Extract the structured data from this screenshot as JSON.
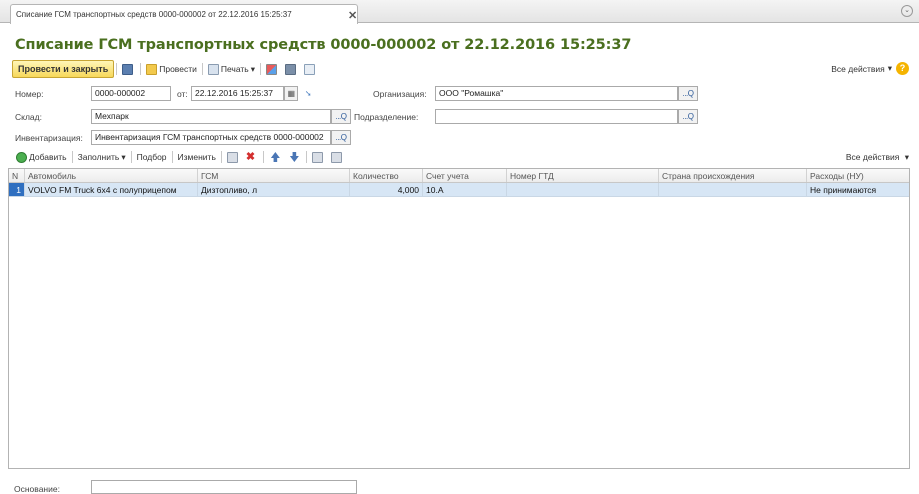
{
  "tab": {
    "title": "Списание ГСМ транспортных средств 0000-000002 от 22.12.2016 15:25:37",
    "close": "✕",
    "menu": "⌄"
  },
  "document": {
    "title": "Списание ГСМ транспортных средств 0000-000002 от 22.12.2016 15:25:37"
  },
  "toolbar": {
    "post_and_close": "Провести и закрыть",
    "post": "Провести",
    "print": "Печать",
    "print_arrow": "▾",
    "all_actions": "Все действия",
    "all_actions_arrow": "▾",
    "help": "?"
  },
  "form": {
    "number_label": "Номер:",
    "number_value": "0000-000002",
    "date_label": "от:",
    "date_value": "22.12.2016 15:25:37",
    "org_label": "Организация:",
    "org_value": "ООО \"Ромашка\"",
    "warehouse_label": "Склад:",
    "warehouse_value": "Мехпарк",
    "department_label": "Подразделение:",
    "department_value": "",
    "inventory_label": "Инвентаризация:",
    "inventory_value": "Инвентаризация ГСМ транспортных средств 0000-000002",
    "select_btn": "...",
    "open_btn": "Q"
  },
  "table_toolbar": {
    "add": "Добавить",
    "fill": "Заполнить",
    "fill_arrow": "▾",
    "select": "Подбор",
    "edit": "Изменить",
    "delete": "✖",
    "all_actions": "Все действия",
    "all_actions_arrow": "▾"
  },
  "table": {
    "columns": [
      "N",
      "Автомобиль",
      "ГСМ",
      "Количество",
      "Счет учета",
      "Номер ГТД",
      "Страна происхождения",
      "Расходы (НУ)"
    ],
    "rows": [
      [
        "1",
        "VOLVO FM Truck 6x4 с полуприцепом",
        "Дизтопливо, л",
        "4,000",
        "10.А",
        "",
        "",
        "Не принимаются"
      ]
    ]
  },
  "footer": {
    "basis_label": "Основание:",
    "basis_value": ""
  }
}
